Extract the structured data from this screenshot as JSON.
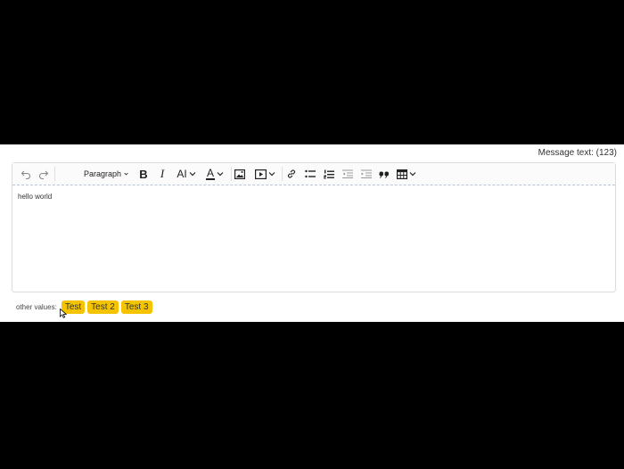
{
  "message_label": "Message text: (123)",
  "toolbar": {
    "paragraph_label": "Paragraph",
    "bold_label": "B",
    "italic_label": "I",
    "font_size_label": "AI",
    "font_color_label": "A",
    "accent_color": "#e8312a"
  },
  "editor": {
    "content": "hello world"
  },
  "other_values": {
    "label": "other values:",
    "chips": [
      "Test",
      "Test 2",
      "Test 3"
    ],
    "chip_color": "#f5c400"
  }
}
